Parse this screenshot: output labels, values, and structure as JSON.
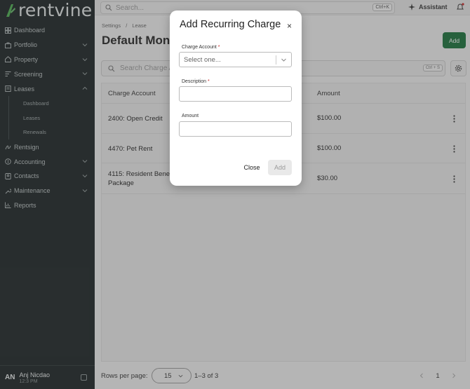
{
  "app": {
    "brand": "rentvine"
  },
  "topbar": {
    "search_placeholder": "Search...",
    "search_shortcut": "Ctrl+K",
    "assistant_label": "Assistant"
  },
  "sidebar": {
    "items": [
      {
        "label": "Dashboard",
        "icon": "dashboard-icon"
      },
      {
        "label": "Portfolio",
        "icon": "portfolio-icon",
        "chevron": "down"
      },
      {
        "label": "Property",
        "icon": "home-icon",
        "chevron": "down"
      },
      {
        "label": "Screening",
        "icon": "screening-icon",
        "chevron": "down"
      },
      {
        "label": "Leases",
        "icon": "leases-icon",
        "chevron": "up"
      }
    ],
    "lease_subitems": [
      "Dashboard",
      "Leases",
      "Renewals"
    ],
    "items_after": [
      {
        "label": "Rentsign",
        "icon": "rentsign-icon"
      },
      {
        "label": "Accounting",
        "icon": "accounting-icon",
        "chevron": "down"
      },
      {
        "label": "Contacts",
        "icon": "contacts-icon",
        "chevron": "down"
      },
      {
        "label": "Maintenance",
        "icon": "wrench-icon",
        "chevron": "down"
      },
      {
        "label": "Reports",
        "icon": "reports-icon"
      }
    ],
    "user": {
      "initials": "AN",
      "name": "Anj Nicdao",
      "time": "12:3 PM"
    }
  },
  "main": {
    "breadcrumb": [
      "Settings",
      "Lease"
    ],
    "title": "Default Month",
    "add_label": "Add",
    "table_search_placeholder": "Search Charge A",
    "table_search_shortcut": "Ctrl + S",
    "columns": [
      "Charge Account",
      "Amount"
    ],
    "rows": [
      {
        "account": "2400: Open Credit",
        "amount": "$100.00"
      },
      {
        "account": "4470: Pet Rent",
        "amount": "$100.00"
      },
      {
        "account": "4115: Resident Benef\nPackage",
        "amount": "$30.00"
      }
    ],
    "pager": {
      "rows_per_page_label": "Rows per page:",
      "rows_per_page_value": "15",
      "range": "1–3 of 3",
      "current_page": "1"
    }
  },
  "modal": {
    "title": "Add Recurring Charge",
    "close_icon": "×",
    "charge_account_label": "Charge Account",
    "charge_account_placeholder": "Select one...",
    "description_label": "Description",
    "amount_label": "Amount",
    "required_mark": "*",
    "close_label": "Close",
    "add_label": "Add"
  },
  "colors": {
    "sidebar_bg": "#1a2122",
    "accent_green": "#17713a",
    "required_red": "#c62828"
  }
}
